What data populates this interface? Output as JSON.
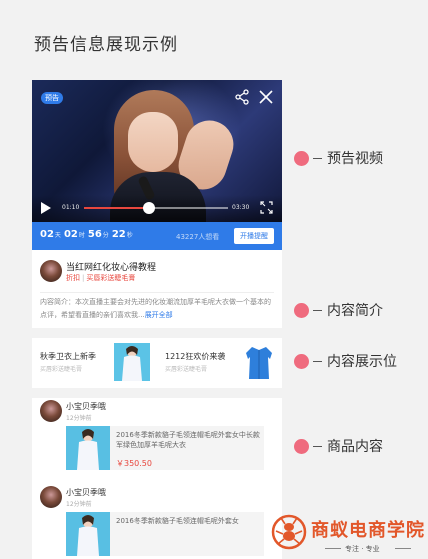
{
  "page": {
    "title": "预告信息展现示例"
  },
  "video": {
    "badge": "预告",
    "current_time": "01:10",
    "total_time": "03:30",
    "progress": 0.45,
    "icons": {
      "share": "share-icon",
      "close": "close-icon",
      "play": "play-icon",
      "fullscreen": "fullscreen-icon"
    }
  },
  "countdown": {
    "days": "02",
    "days_unit": "天",
    "hours": "02",
    "hours_unit": "时",
    "minutes": "56",
    "minutes_unit": "分",
    "seconds": "22",
    "seconds_unit": "秒",
    "viewers": "43227人想看",
    "remind_button": "开播提醒"
  },
  "intro": {
    "title": "当红网红化妆心得教程",
    "tag_discount": "折扣",
    "tag_separator": "|",
    "tag_gift": "买唇彩送睫毛膏",
    "description": "内容简介：本次直播主要会对先进的化妆潮流加厚羊毛呢大衣做一个基本的点评，希望看直播的亲们喜欢我...",
    "expand_label": "展开全部"
  },
  "showcase": [
    {
      "name": "秋季卫衣上新季",
      "sub": "买唇彩送睫毛膏"
    },
    {
      "name": "1212狂欢价来袭",
      "sub": "买唇彩送睫毛膏"
    }
  ],
  "feed": [
    {
      "user": "小宝贝季哦",
      "time": "12分钟前",
      "product_name": "2016冬季新款貉子毛领连帽毛呢外套女中长款军绿色加厚羊毛呢大衣",
      "price": "￥350.50"
    },
    {
      "user": "小宝贝季哦",
      "time": "12分钟前",
      "product_name": "2016冬季新款貉子毛领连帽毛呢外套女",
      "price": ""
    }
  ],
  "annotations": [
    {
      "label": "预告视频"
    },
    {
      "label": "内容简介"
    },
    {
      "label": "内容展示位"
    },
    {
      "label": "商品内容"
    }
  ],
  "logo": {
    "text": "商蚁电商学院",
    "slogan": "专注 · 专业"
  },
  "colors": {
    "accent_blue": "#2f7be8",
    "accent_red": "#e8473e",
    "annotation_dot": "#ef6b7e",
    "logo_orange": "#e2572a"
  }
}
